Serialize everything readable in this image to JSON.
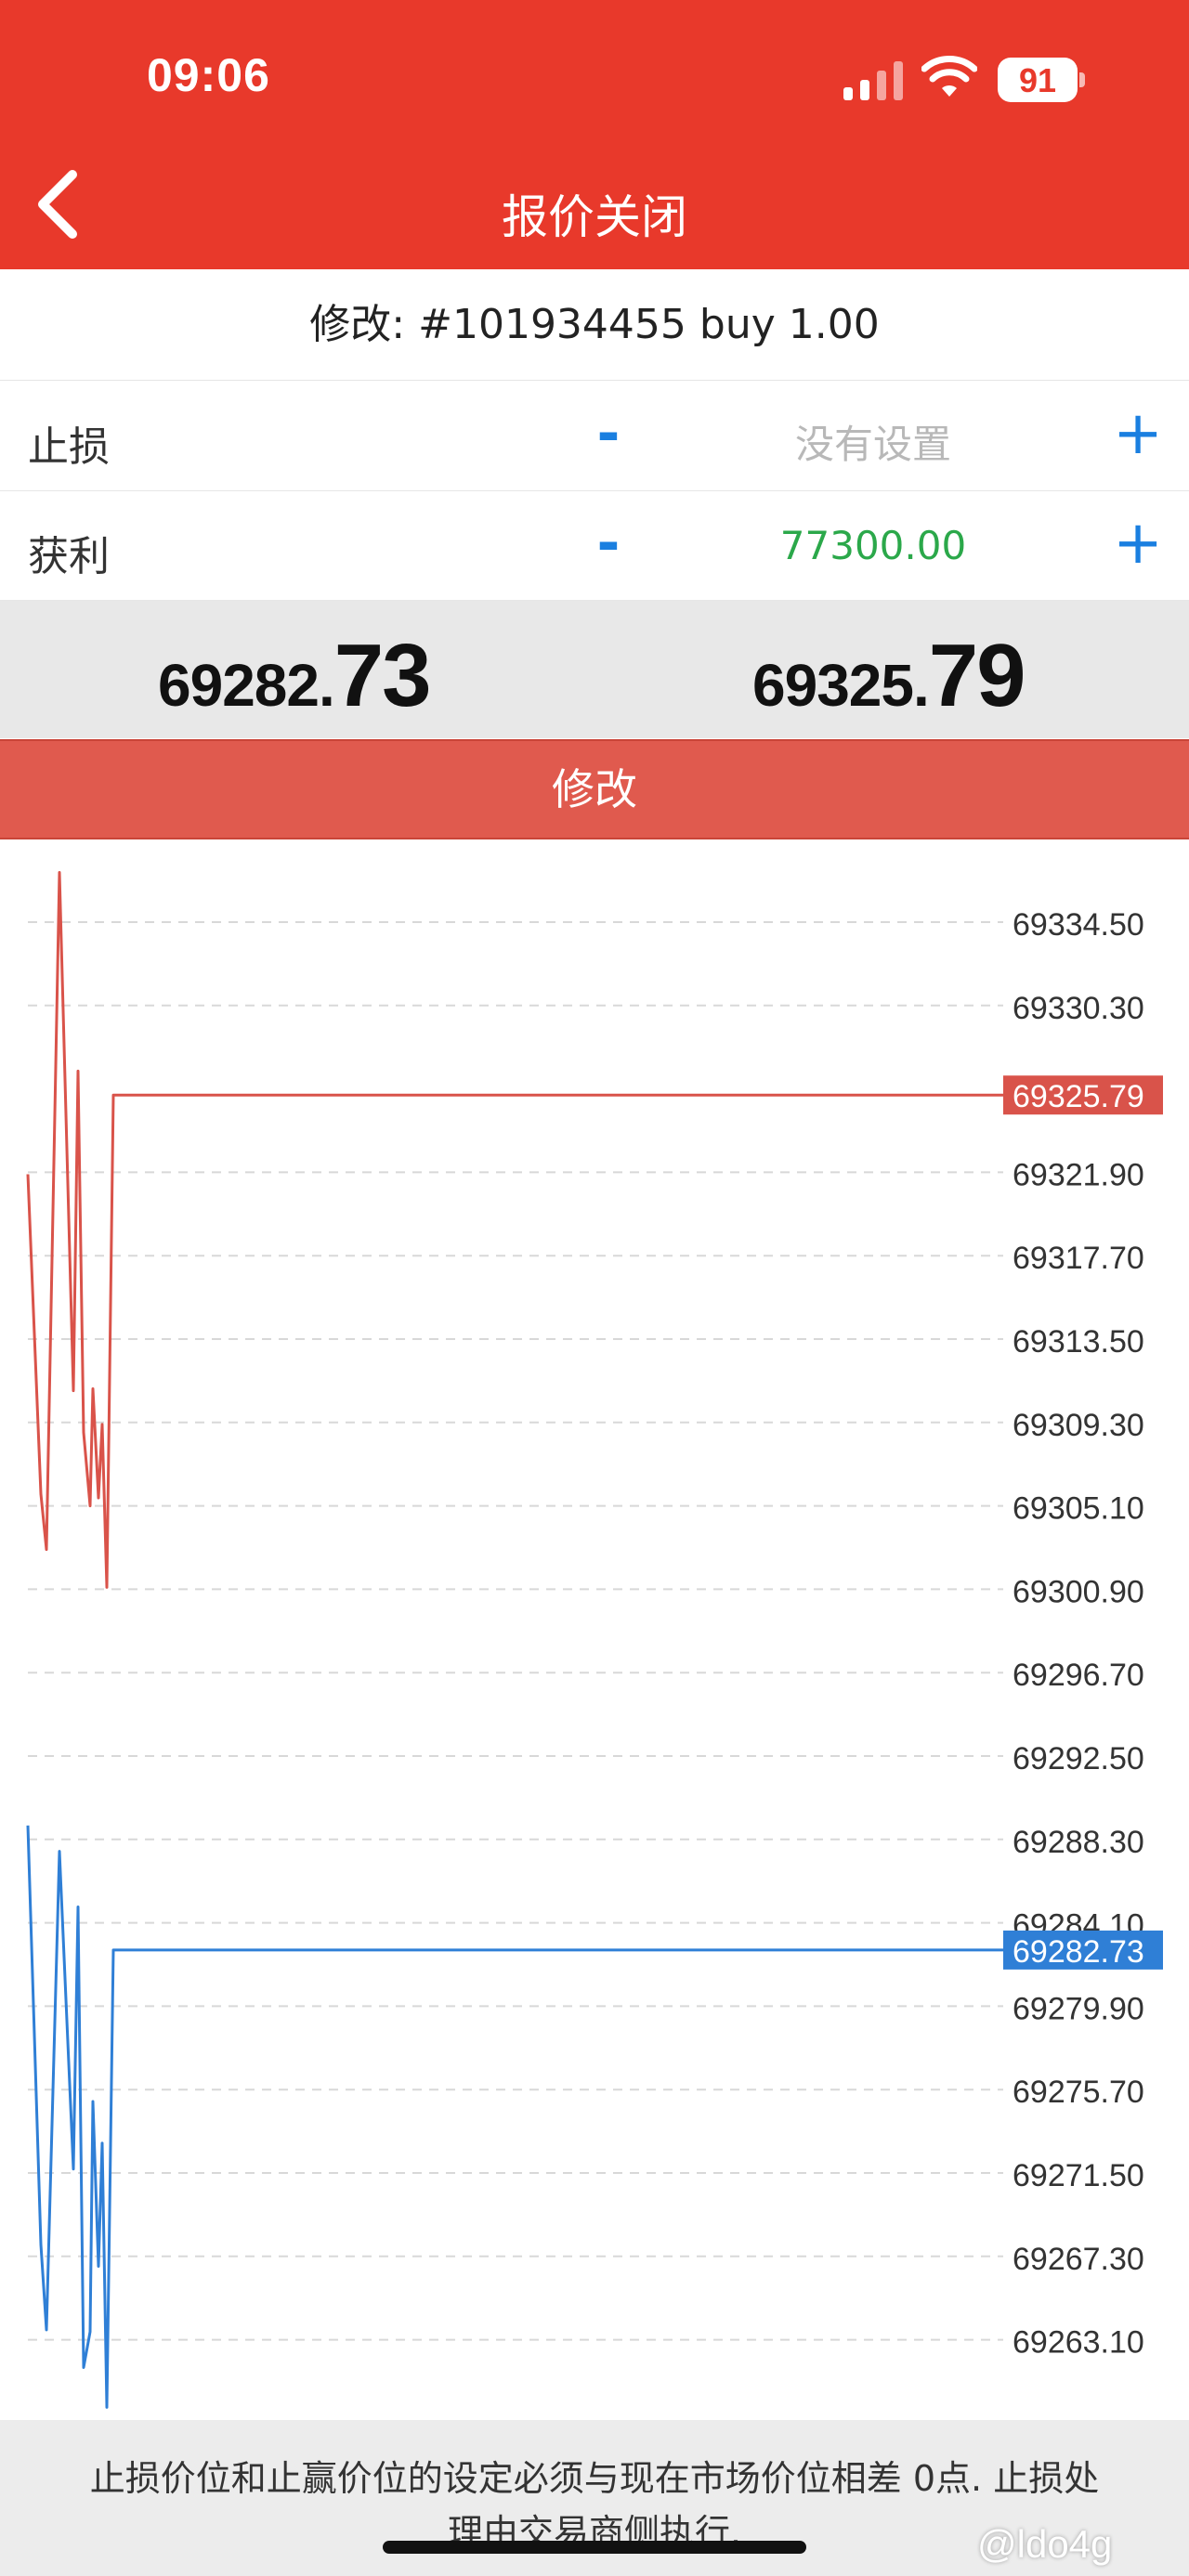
{
  "status": {
    "time": "09:06",
    "battery": "91"
  },
  "nav": {
    "title": "报价关闭"
  },
  "order": {
    "text": "修改: #101934455 buy 1.00"
  },
  "stop_loss": {
    "label": "止损",
    "minus": "-",
    "value": "没有设置",
    "plus": "+"
  },
  "take_profit": {
    "label": "获利",
    "minus": "-",
    "value": "77300.00",
    "plus": "+"
  },
  "quotes": {
    "bid_small": "69282.",
    "bid_big": "73",
    "ask_small": "69325.",
    "ask_big": "79"
  },
  "action": {
    "modify_label": "修改"
  },
  "colors": {
    "header": "#e8392b",
    "ask_line": "#d9534a",
    "bid_line": "#2f7fd6",
    "take_profit": "#2ba84a",
    "accent": "#1a7fe0"
  },
  "chart_data": {
    "type": "line",
    "y_ticks": [
      "69334.50",
      "69330.30",
      "69325.79",
      "69321.90",
      "69317.70",
      "69313.50",
      "69309.30",
      "69305.10",
      "69300.90",
      "69296.70",
      "69292.50",
      "69288.30",
      "69284.10",
      "69279.90",
      "69275.70",
      "69271.50",
      "69267.30",
      "69263.10"
    ],
    "current_ask": "69325.79",
    "current_bid": "69282.73",
    "ylim": [
      69260.0,
      69338.0
    ],
    "series": [
      {
        "role": "ask",
        "values": [
          69321.8,
          69305.7,
          69302.9,
          69337.0,
          69310.9,
          69327.0,
          69308.8,
          69305.1,
          69311.0,
          69305.5,
          69309.2,
          69301.0,
          69325.79,
          69325.79,
          69325.79
        ]
      },
      {
        "role": "bid",
        "values": [
          69289.0,
          69267.9,
          69263.6,
          69287.7,
          69271.7,
          69284.9,
          69261.7,
          69263.5,
          69275.1,
          69266.8,
          69273.0,
          69259.7,
          69282.73,
          69282.73,
          69282.73
        ]
      }
    ]
  },
  "footer": {
    "notice_line1": "止损价位和止赢价位的设定必须与现在市场价位相差 0点. 止损处",
    "notice_line2": "理由交易商侧执行.",
    "watermark": "@ldo4g"
  }
}
